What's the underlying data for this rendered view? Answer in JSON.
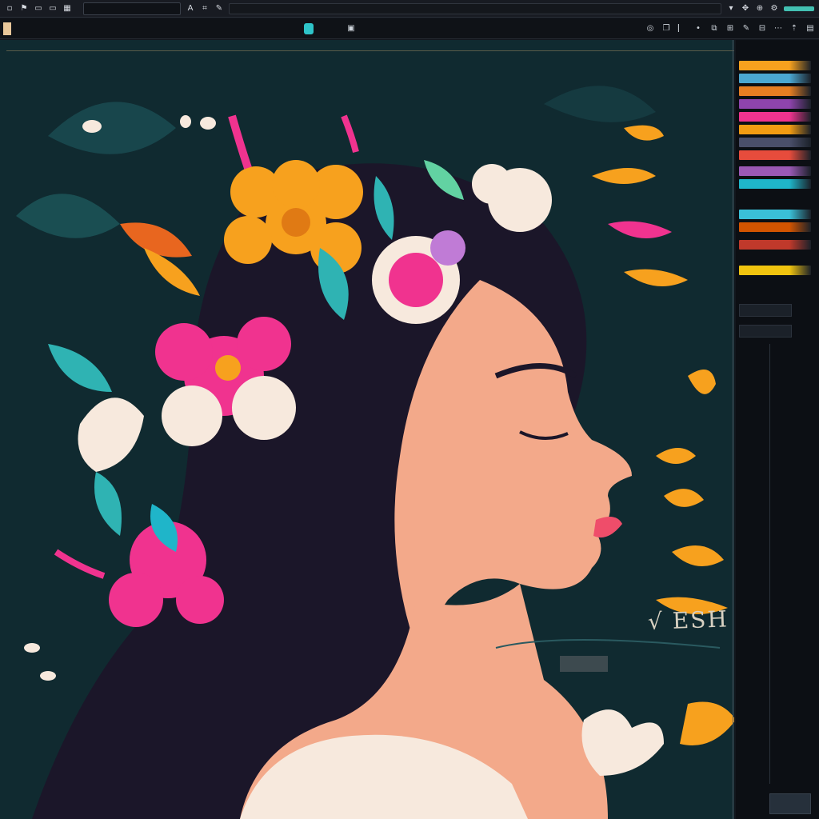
{
  "app": {
    "menubar_icons": [
      "square-icon",
      "flag-icon",
      "page-icon",
      "page-icon",
      "grid-icon",
      "text-icon",
      "crop-icon",
      "brush-icon"
    ],
    "toolbar_title": "",
    "toolbar_center_texts": [
      "",
      "",
      ""
    ]
  },
  "canvas": {
    "colors": {
      "background": "#102a30",
      "hair": "#1b1629",
      "skin": "#f3a98a",
      "pink": "#f0338f",
      "orange": "#f7a11e",
      "teal": "#2fb3b3",
      "cream": "#f7e9dd"
    },
    "sketch_text": "√ ESH ST/"
  },
  "layers_panel": {
    "header": "",
    "layers": [
      {
        "label": "",
        "color": "#f7a11e"
      },
      {
        "label": "",
        "color": "#4ba7d1"
      },
      {
        "label": "",
        "color": "#e67e22"
      },
      {
        "label": "",
        "color": "#8e44ad"
      },
      {
        "label": "",
        "color": "#f0338f"
      },
      {
        "label": "",
        "color": "#f39c12"
      },
      {
        "label": "",
        "color": "#4a4f6a"
      },
      {
        "label": "",
        "color": "#e74c3c"
      },
      {
        "label": "",
        "color": "#9b59b6"
      },
      {
        "label": "",
        "color": "#1fb5c9"
      },
      {
        "label": "",
        "color": "#3ac0d8"
      },
      {
        "label": "",
        "color": "#d35400"
      },
      {
        "label": "",
        "color": "#c0392b"
      },
      {
        "label": "",
        "color": "#f1c40f"
      }
    ]
  }
}
